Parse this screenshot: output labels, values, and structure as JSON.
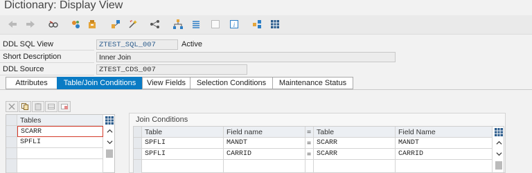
{
  "window": {
    "title": "Dictionary: Display View"
  },
  "toolbar": {
    "icons": [
      "back-arrow-icon",
      "forward-arrow-icon",
      "glasses-icon",
      "where-used-icon",
      "object-list-icon",
      "hierarchy-icon",
      "activate-icon",
      "navigate-icon",
      "structure-icon",
      "list-icon",
      "blank-icon",
      "info-icon",
      "graph-icon",
      "table-icon"
    ]
  },
  "fields": {
    "ddl_sql_view_label": "DDL SQL View",
    "ddl_sql_view_value": "ZTEST_SQL_007",
    "status": "Active",
    "short_desc_label": "Short Description",
    "short_desc_value": "Inner Join",
    "ddl_source_label": "DDL Source",
    "ddl_source_value": "ZTEST_CDS_007"
  },
  "tabs": {
    "attributes": "Attributes",
    "table_join": "Table/Join Conditions",
    "view_fields": "View Fields",
    "selection": "Selection Conditions",
    "maintenance": "Maintenance Status",
    "active_tab": "Table/Join Conditions"
  },
  "tables_grid": {
    "header": "Tables",
    "rows": [
      "SCARR",
      "SPFLI"
    ]
  },
  "join_conditions": {
    "title": "Join Conditions",
    "headers": {
      "table1": "Table",
      "field1": "Field name",
      "eq": "=",
      "table2": "Table",
      "field2": "Field Name"
    },
    "rows": [
      {
        "table1": "SPFLI",
        "field1": "MANDT",
        "eq": "=",
        "table2": "SCARR",
        "field2": "MANDT"
      },
      {
        "table1": "SPFLI",
        "field1": "CARRID",
        "eq": "=",
        "table2": "SCARR",
        "field2": "CARRID"
      }
    ]
  },
  "colors": {
    "accent": "#0a7bc4",
    "selected_cell_border": "#d43a2a"
  }
}
